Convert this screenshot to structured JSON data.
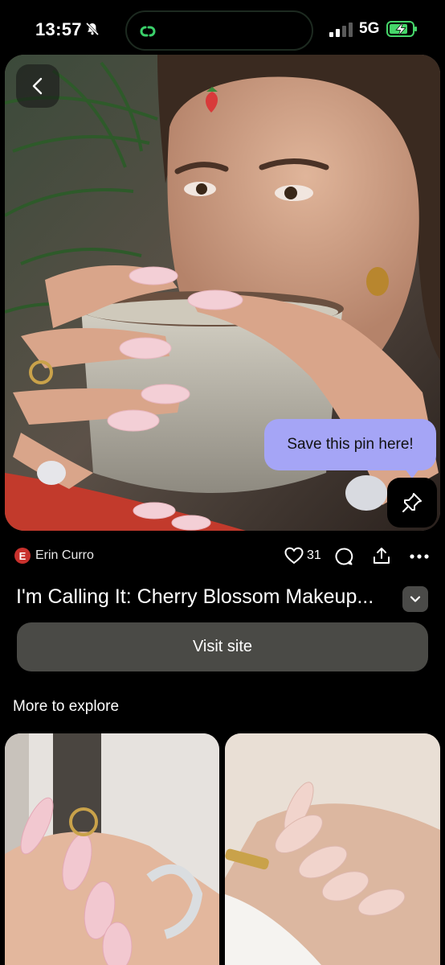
{
  "status_bar": {
    "time": "13:57",
    "network": "5G",
    "icons": [
      "bell-slash-icon",
      "link-icon",
      "signal-icon",
      "battery-charging-icon"
    ]
  },
  "hero": {
    "tooltip_text": "Save this pin here!",
    "icons": [
      "chevron-left-icon",
      "pin-icon"
    ]
  },
  "pin": {
    "author_initial": "E",
    "author_name": "Erin Curro",
    "like_count": "31",
    "title": "I'm Calling It: Cherry Blossom Makeup...",
    "visit_label": "Visit site"
  },
  "explore": {
    "section_title": "More to explore"
  },
  "colors": {
    "background": "#000000",
    "tooltip": "#a5a5f6",
    "button": "#4a4a46",
    "avatar": "#c8312d"
  }
}
